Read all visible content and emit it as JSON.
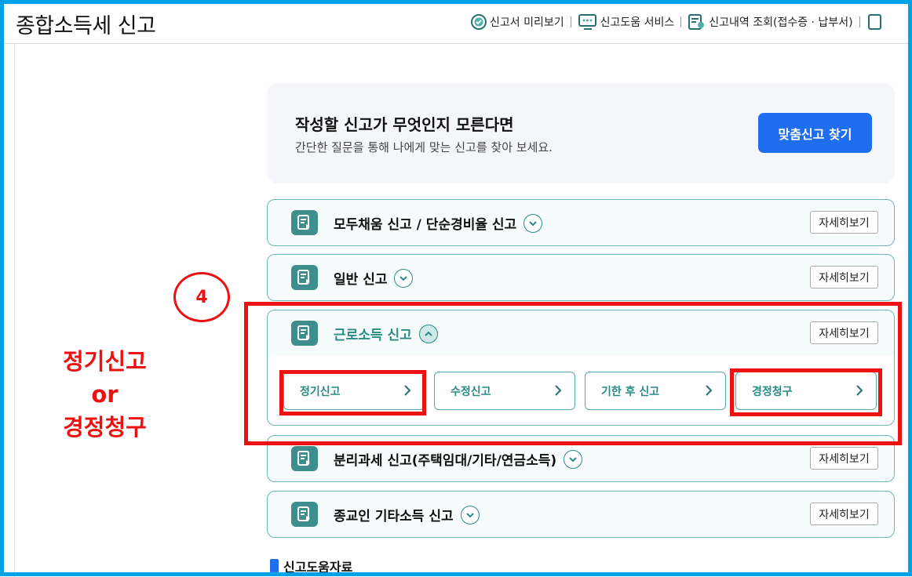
{
  "header": {
    "title": "종합소득세 신고",
    "links": [
      {
        "label": "신고서 미리보기",
        "icon": "preview-check-icon"
      },
      {
        "label": "신고도움 서비스",
        "icon": "monitor-help-icon"
      },
      {
        "label": "신고내역 조회(접수증 · 납부서)",
        "icon": "document-search-icon"
      }
    ]
  },
  "banner": {
    "title": "작성할 신고가 무엇인지 모른다면",
    "subtitle": "간단한 질문을 통해 나에게 맞는 신고를 찾아 보세요.",
    "button": "맞춤신고 찾기"
  },
  "accordion": [
    {
      "title": "모두채움 신고 / 단순경비율 신고",
      "detail": "자세히보기",
      "expanded": false
    },
    {
      "title": "일반 신고",
      "detail": "자세히보기",
      "expanded": false
    },
    {
      "title": "근로소득 신고",
      "detail": "자세히보기",
      "expanded": true,
      "subs": [
        "정기신고",
        "수정신고",
        "기한 후 신고",
        "경정청구"
      ]
    },
    {
      "title": "분리과세 신고(주택임대/기타/연금소득)",
      "detail": "자세히보기",
      "expanded": false
    },
    {
      "title": "종교인 기타소득 신고",
      "detail": "자세히보기",
      "expanded": false
    }
  ],
  "help_docs": "신고도움자료",
  "annotation": {
    "step": "4",
    "line1": "정기신고",
    "line2": "or",
    "line3": "경정청구",
    "color": "#ee1111"
  },
  "colors": {
    "accent": "#1f6ef0",
    "teal": "#2a8a86",
    "border": "#00a2e8"
  }
}
